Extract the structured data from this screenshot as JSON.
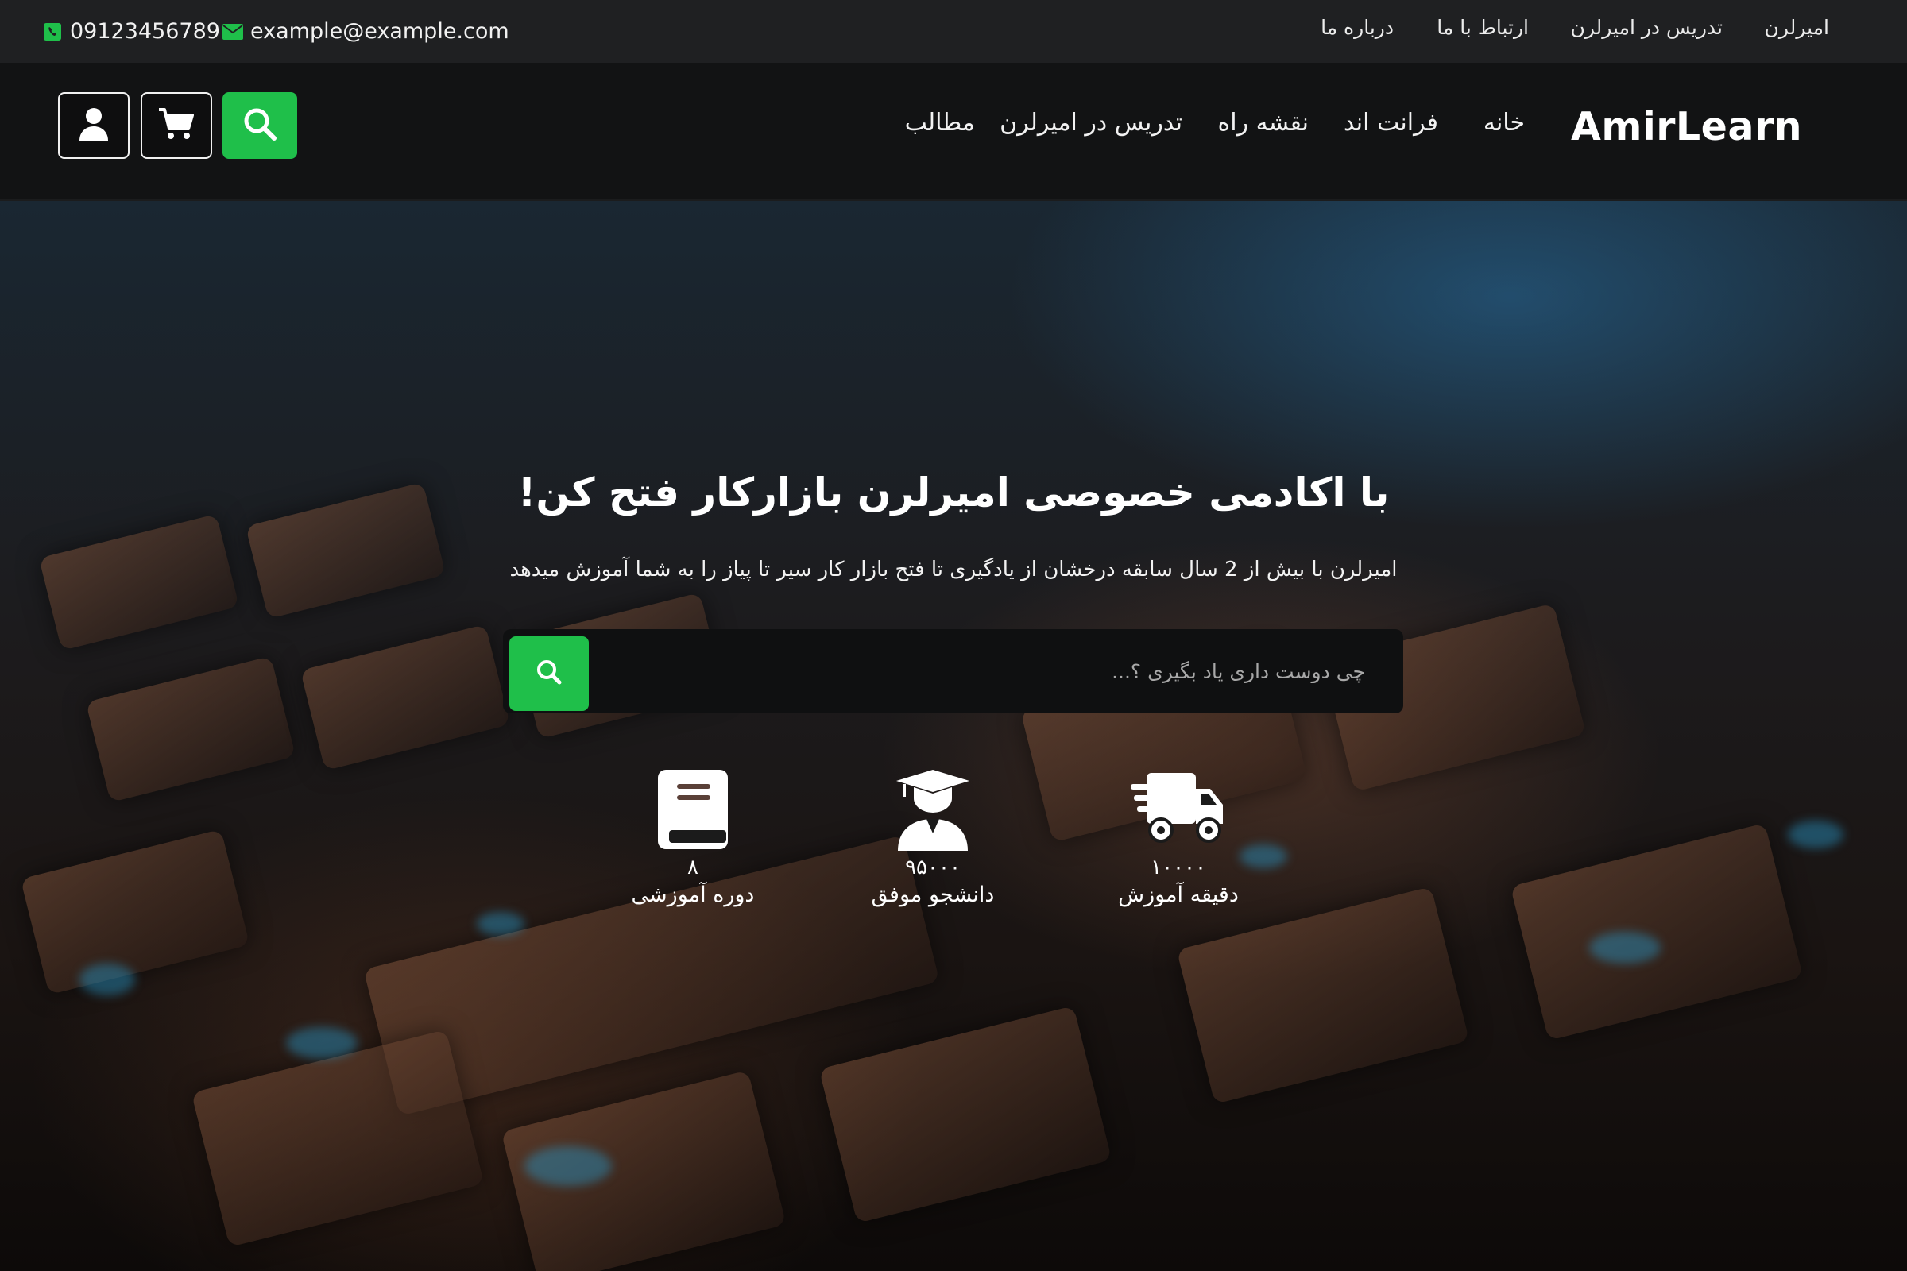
{
  "topbar": {
    "phone": "09123456789",
    "email": "example@example.com",
    "links": [
      "امیرلرن",
      "تدریس در امیرلرن",
      "ارتباط با ما",
      "درباره ما"
    ]
  },
  "header": {
    "logo": "AmirLearn",
    "nav": [
      "خانه",
      "فرانت اند",
      "نقشه راه",
      "تدریس در امیرلرن",
      "مطالب"
    ]
  },
  "hero": {
    "title": "با اکادمی خصوصی امیرلرن بازارکار فتح کن!",
    "subtitle": "امیرلرن با بیش از 2 سال سابقه درخشان از یادگیری تا فتح بازار کار سیر تا پیاز را به شما آموزش میدهد",
    "search_placeholder": "چی دوست داری یاد بگیری ؟...",
    "stats": [
      {
        "icon": "book-icon",
        "value": "۸",
        "label": "دوره آموزشی"
      },
      {
        "icon": "graduation-cap-icon",
        "value": "۹۵۰۰۰",
        "label": "دانشجو موفق"
      },
      {
        "icon": "truck-icon",
        "value": "۱۰۰۰۰",
        "label": "دقیقه آموزش"
      }
    ]
  },
  "colors": {
    "accent": "#1fbf4a",
    "topbar_bg": "#1f2022",
    "navbar_bg": "#121314"
  }
}
